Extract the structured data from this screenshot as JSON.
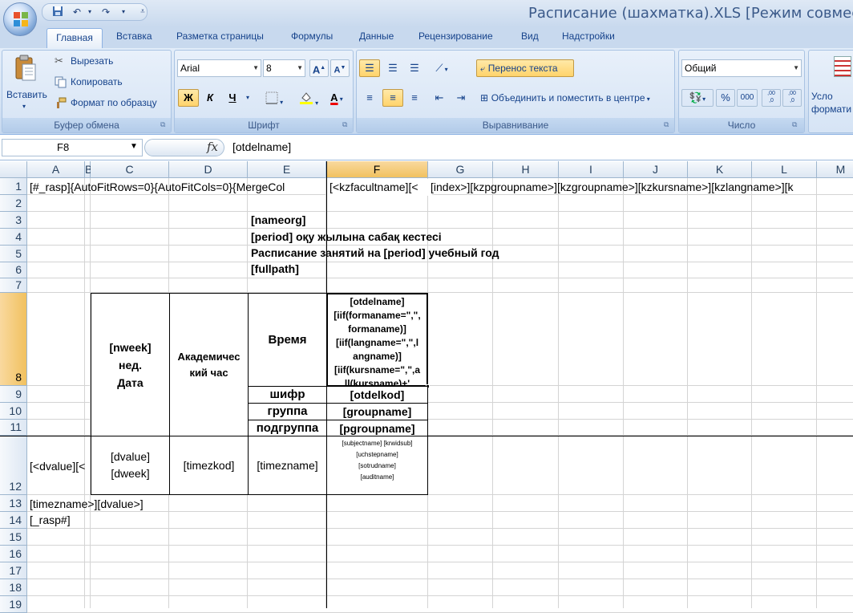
{
  "app": {
    "title": "Расписание (шахматка).XLS  [Режим совместим"
  },
  "tabs": [
    "Главная",
    "Вставка",
    "Разметка страницы",
    "Формулы",
    "Данные",
    "Рецензирование",
    "Вид",
    "Надстройки"
  ],
  "clipboard": {
    "paste": "Вставить",
    "cut": "Вырезать",
    "copy": "Копировать",
    "format_painter": "Формат по образцу",
    "label": "Буфер обмена"
  },
  "font": {
    "name": "Arial",
    "size": "8",
    "label": "Шрифт",
    "bold": "Ж",
    "italic": "К",
    "underline": "Ч"
  },
  "alignment": {
    "wrap": "Перенос текста",
    "merge": "Объединить и поместить в центре",
    "label": "Выравнивание"
  },
  "number": {
    "format": "Общий",
    "label": "Число",
    "percent": "%",
    "thousands": "000",
    "inc_decimal": ",00\n,0",
    "dec_decimal": ",00\n,0"
  },
  "styles": {
    "cond_label": "Усло\nформати"
  },
  "formula": {
    "cell": "F8",
    "fx": "fx",
    "value": "[otdelname]"
  },
  "columns": [
    "",
    "A",
    "B",
    "C",
    "D",
    "E",
    "F",
    "G",
    "H",
    "I",
    "J",
    "K",
    "L",
    "M"
  ],
  "rows": [
    "1",
    "2",
    "3",
    "4",
    "5",
    "6",
    "7",
    "8",
    "9",
    "10",
    "11",
    "12",
    "13",
    "14",
    "15",
    "16",
    "17",
    "18",
    "19"
  ],
  "cells": {
    "r1a": "[#_rasp]{AutoFitRows=0}{AutoFitCols=0}{MergeCol",
    "r1f": "[<kzfacultname][<",
    "r1g": "[index>][kzpgroupname>][kzgroupname>][kzkursname>][kzlangname>][k",
    "r3": "[nameorg]",
    "r4": "[period]  оқу жылына сабақ кестесі",
    "r5": "Расписание занятий на [period] учебный год",
    "r6": "[fullpath]",
    "c8": "[nweek]\nнед.\nДата",
    "d8": "Академичес\nкий час",
    "e8": "Время",
    "f8": "[otdelname]\n[iif(formaname=\",\",\nformaname)]\n[iif(langname=\",\",l\nangname)]\n[iif(kursname=\",\",a\nll(kursname)+'",
    "e9": "шифр",
    "f9": "[otdelkod]",
    "e10": "группа",
    "f10": "[groupname]",
    "e11": "подгруппа",
    "f11": "[pgroupname]",
    "a12": "[<dvalue][<",
    "c12": "[dvalue]\n[dweek]",
    "d12": "[timezkod]",
    "e12": "[timezname]",
    "f12": "[subjectname] [krwidsub]\n[uchstepname]\n[sotrudname]\n[auditname]",
    "a13": "[timezname>][dvalue>]",
    "a14": "[_rasp#]"
  }
}
